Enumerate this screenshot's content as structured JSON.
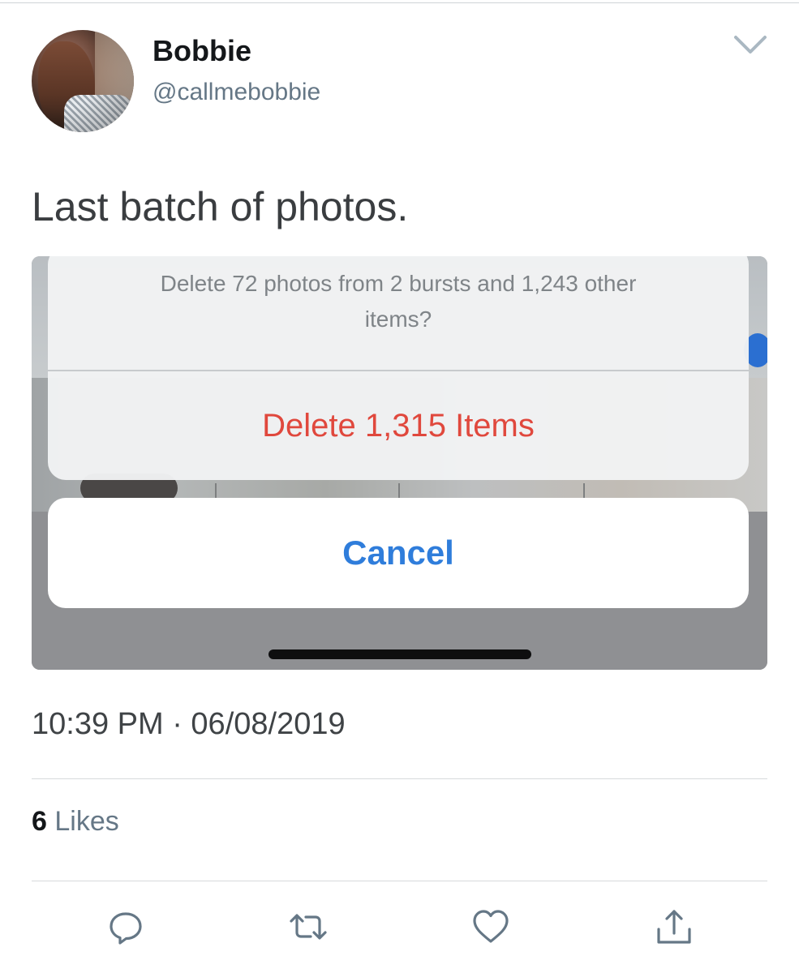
{
  "tweet": {
    "author": {
      "display_name": "Bobbie",
      "handle": "@callmebobbie"
    },
    "text": "Last batch of photos.",
    "media": {
      "sheet_message": "Delete 72 photos from 2 bursts and 1,243 other items?",
      "destructive_action": "Delete 1,315 Items",
      "cancel_action": "Cancel"
    },
    "timestamp": "10:39 PM · 06/08/2019",
    "likes": {
      "count": "6",
      "label": "Likes"
    },
    "actions": [
      "reply-icon",
      "retweet-icon",
      "like-icon",
      "share-icon"
    ]
  },
  "colors": {
    "destructive": "#e0483d",
    "ios_blue": "#2f7ddb",
    "secondary_text": "#657786"
  }
}
